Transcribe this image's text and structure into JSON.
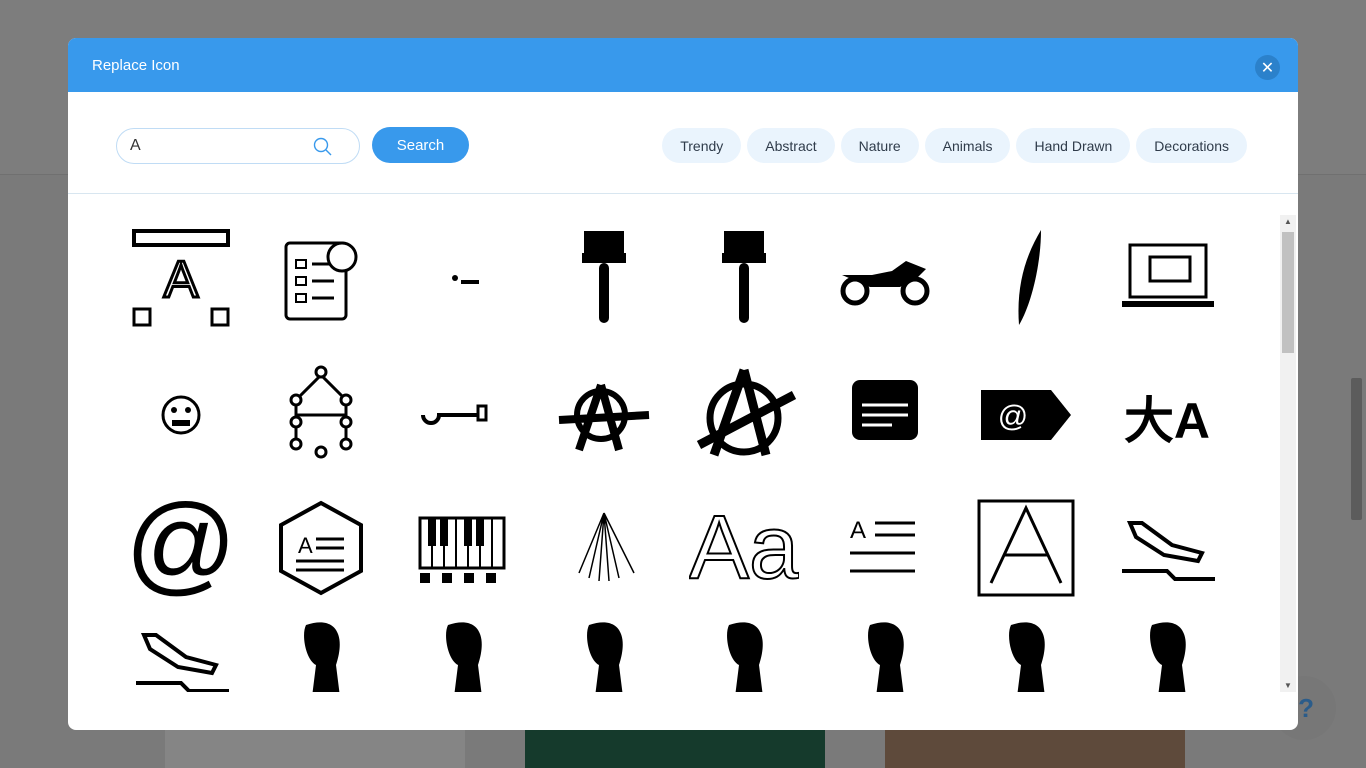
{
  "modal": {
    "title": "Replace Icon",
    "close_icon": "close-icon"
  },
  "search": {
    "value": "A",
    "button": "Search",
    "icon": "search-icon"
  },
  "categories": [
    "Trendy",
    "Abstract",
    "Nature",
    "Animals",
    "Hand Drawn",
    "Decorations"
  ],
  "icons": [
    "text-frame-a",
    "checklist-badge",
    "dot-dash",
    "paint-brush",
    "paint-brush",
    "motorcycle",
    "feather-quill",
    "laptop-presentation",
    "angry-face",
    "node-letter-a",
    "key",
    "anarchy-symbol",
    "anarchy-symbol-bold",
    "grade-document",
    "email-tag",
    "translate",
    "at-sign",
    "hexagon-text",
    "piano-keys",
    "fan-lines",
    "font-aa",
    "text-lines-a",
    "boxed-a",
    "plane-landing",
    "plane-landing",
    "glyph-1",
    "glyph-2",
    "glyph-3",
    "glyph-4",
    "glyph-5",
    "glyph-6",
    "glyph-7"
  ],
  "help": {
    "label": "?"
  },
  "colors": {
    "accent": "#3899ec",
    "chip_bg": "#eaf4fd"
  }
}
